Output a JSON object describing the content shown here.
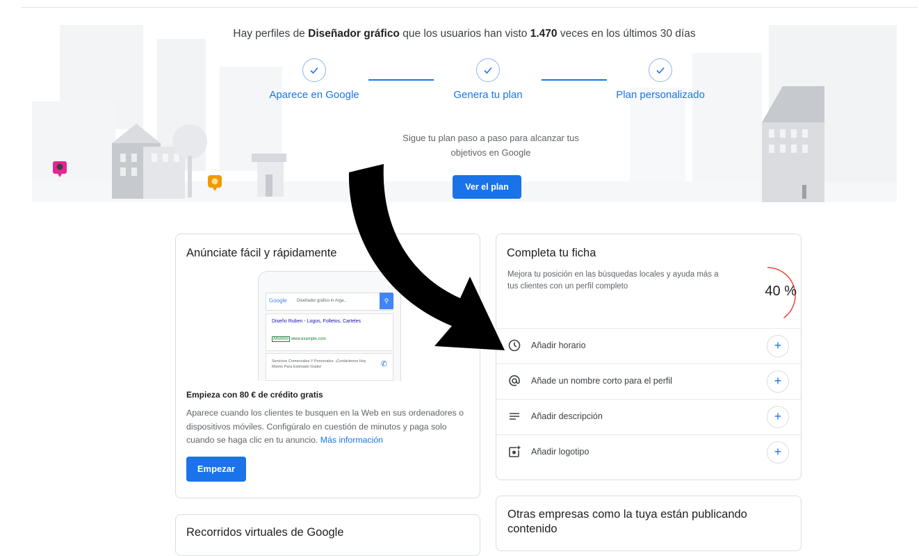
{
  "hero": {
    "headline_pre": "Hay perfiles de ",
    "headline_bold1": "Diseñador gráfico",
    "headline_mid": " que los usuarios han visto ",
    "headline_bold2": "1.470",
    "headline_post": " veces en los últimos 30 días",
    "steps": [
      {
        "label": "Aparece en Google",
        "icon": "check-circle-icon"
      },
      {
        "label": "Genera tu plan",
        "icon": "check-circle-icon"
      },
      {
        "label": "Plan personalizado",
        "icon": "check-circle-icon"
      }
    ],
    "subtitle": "Sigue tu plan paso a paso para alcanzar tus objetivos en Google",
    "button_label": "Ver el plan"
  },
  "ads_card": {
    "title": "Anúnciate fácil y rápidamente",
    "preview": {
      "google_logo": "Google",
      "query": "Diseñador gráfico in Arga...",
      "ad_title": "Diseño Ruben - Logos, Folletos, Carteles",
      "ad_badge": "Anuncio",
      "ad_url": "www.example.com",
      "ad2_text": "Servicios Comerciales Y Personales. ¡Contáctenos Hoy Mismo Para Estimado Gratis!"
    },
    "promo_bold": "Empieza con 80 € de crédito gratis",
    "body": "Aparece cuando los clientes te busquen en la Web en sus ordenadores o dispositivos móviles. Configúralo en cuestión de minutos y paga solo cuando se haga clic en tu anuncio. ",
    "link": "Más información",
    "button_label": "Empezar"
  },
  "profile_card": {
    "title": "Completa tu ficha",
    "subtitle": "Mejora tu posición en las búsquedas locales y ayuda más a tus clientes con un perfil completo",
    "progress_text": "40 %",
    "progress_value": 0.4,
    "tasks": [
      {
        "label": "Añadir horario",
        "icon": "clock-icon"
      },
      {
        "label": "Añade un nombre corto para el perfil",
        "icon": "at-sign-icon"
      },
      {
        "label": "Añadir descripción",
        "icon": "text-lines-icon"
      },
      {
        "label": "Añadir logotipo",
        "icon": "add-photo-icon"
      }
    ],
    "add_symbol": "+"
  },
  "tours_card": {
    "title": "Recorridos virtuales de Google"
  },
  "others_card": {
    "title": "Otras empresas como la tuya están publicando contenido"
  },
  "colors": {
    "accent": "#1a73e8",
    "progress_ring": "#ea4335",
    "arrow": "#000000"
  }
}
